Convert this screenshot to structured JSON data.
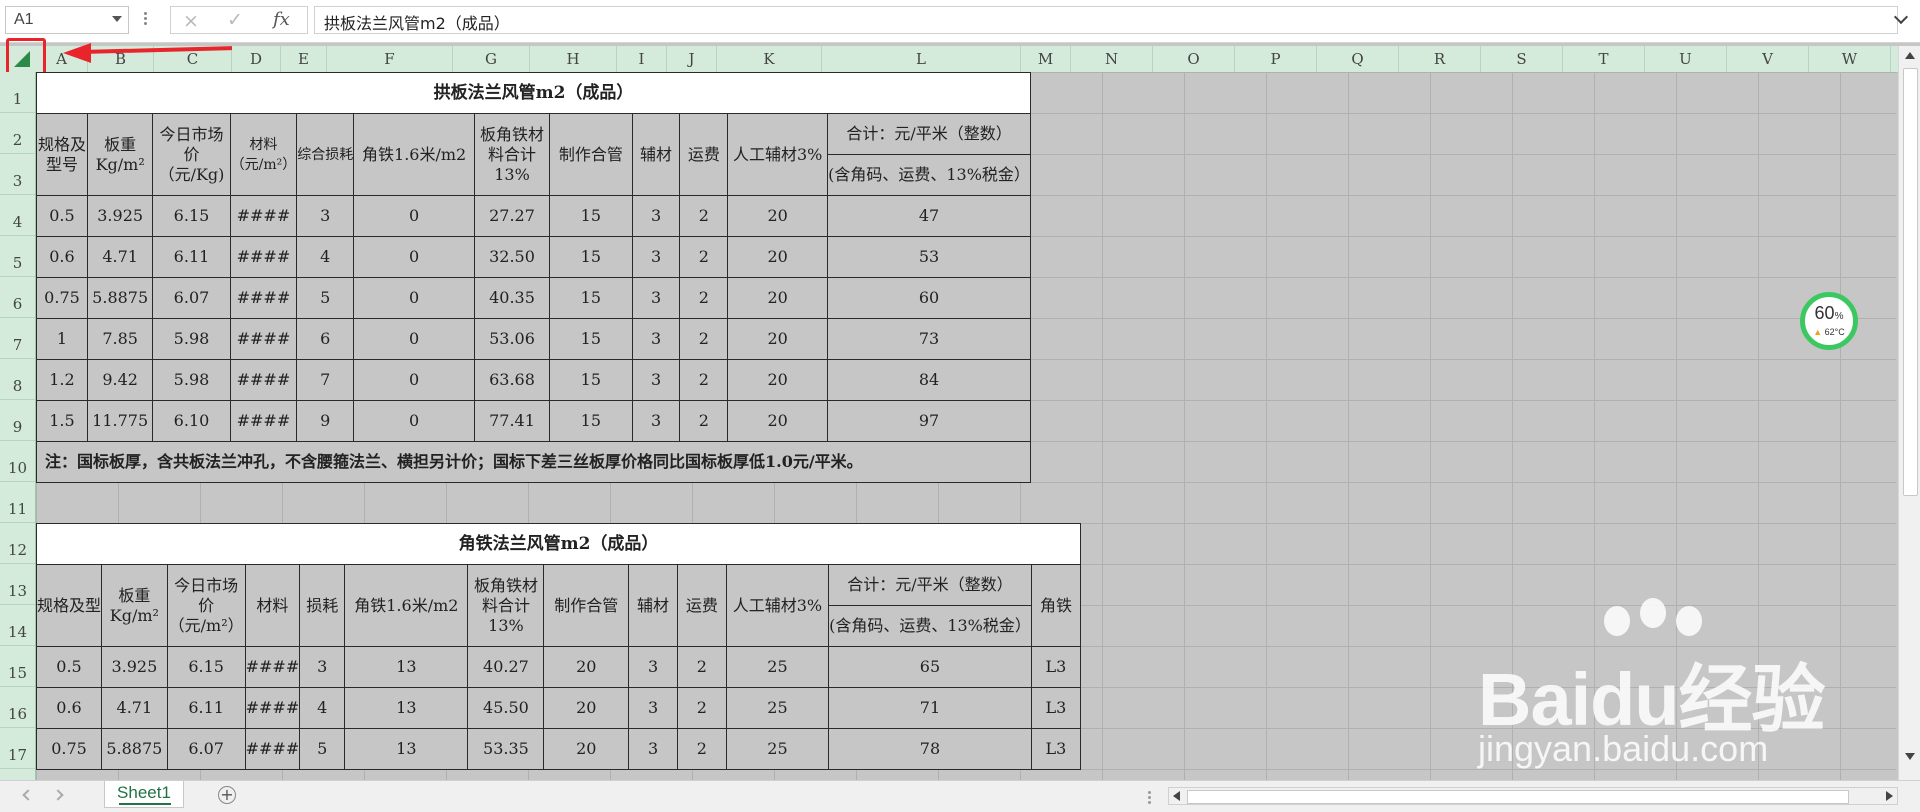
{
  "formula_bar": {
    "name_box": "A1",
    "cancel_icon": "×",
    "enter_icon": "✓",
    "fx_label": "fx",
    "formula": "拱板法兰风管m2（成品）"
  },
  "columns": [
    "A",
    "B",
    "C",
    "D",
    "E",
    "F",
    "G",
    "H",
    "I",
    "J",
    "K",
    "L",
    "M",
    "N",
    "O",
    "P",
    "Q",
    "R",
    "S",
    "T",
    "U",
    "V",
    "W"
  ],
  "rows": [
    "1",
    "2",
    "3",
    "4",
    "5",
    "6",
    "7",
    "8",
    "9",
    "10",
    "11",
    "12",
    "13",
    "14",
    "15",
    "16",
    "17"
  ],
  "table1": {
    "title": "拱板法兰风管m2（成品）",
    "headers": {
      "spec": "规格及型号",
      "weight": "板重Kg/m²",
      "price": "今日市场价 （元/Kg)",
      "material": "材料（元/m²）",
      "loss": "综合损耗",
      "angle": "角铁1.6米/m2",
      "board_sum": "板角铁材料合计13%",
      "make": "制作合管",
      "aux": "辅材",
      "freight": "运费",
      "labor": "人工辅材3%",
      "total": "合计：元/平米（整数）",
      "total_sub": "(含角码、运费、13%税金）"
    },
    "rows": [
      [
        "0.5",
        "3.925",
        "6.15",
        "####",
        "3",
        "0",
        "27.27",
        "15",
        "3",
        "2",
        "20",
        "47"
      ],
      [
        "0.6",
        "4.71",
        "6.11",
        "####",
        "4",
        "0",
        "32.50",
        "15",
        "3",
        "2",
        "20",
        "53"
      ],
      [
        "0.75",
        "5.8875",
        "6.07",
        "####",
        "5",
        "0",
        "40.35",
        "15",
        "3",
        "2",
        "20",
        "60"
      ],
      [
        "1",
        "7.85",
        "5.98",
        "####",
        "6",
        "0",
        "53.06",
        "15",
        "3",
        "2",
        "20",
        "73"
      ],
      [
        "1.2",
        "9.42",
        "5.98",
        "####",
        "7",
        "0",
        "63.68",
        "15",
        "3",
        "2",
        "20",
        "84"
      ],
      [
        "1.5",
        "11.775",
        "6.10",
        "####",
        "9",
        "0",
        "77.41",
        "15",
        "3",
        "2",
        "20",
        "97"
      ]
    ],
    "note": "注：国标板厚，含共板法兰冲孔，不含腰箍法兰、横担另计价；国标下差三丝板厚价格同比国标板厚低1.0元/平米。"
  },
  "table2": {
    "title": "角铁法兰风管m2（成品）",
    "headers": {
      "spec": "规格及型",
      "weight": "板重Kg/m²",
      "price": "今日市场价 （元/m²）",
      "material": "材料",
      "loss": "损耗",
      "angle": "角铁1.6米/m2",
      "board_sum": "板角铁材料合计13%",
      "make": "制作合管",
      "aux": "辅材",
      "freight": "运费",
      "labor": "人工辅材3%",
      "total": "合计：元/平米（整数）",
      "total_sub": "(含角码、运费、13%税金）",
      "angle_spec": "角铁"
    },
    "rows": [
      [
        "0.5",
        "3.925",
        "6.15",
        "####",
        "3",
        "13",
        "40.27",
        "20",
        "3",
        "2",
        "25",
        "65",
        "L3"
      ],
      [
        "0.6",
        "4.71",
        "6.11",
        "####",
        "4",
        "13",
        "45.50",
        "20",
        "3",
        "2",
        "25",
        "71",
        "L3"
      ],
      [
        "0.75",
        "5.8875",
        "6.07",
        "####",
        "5",
        "13",
        "53.35",
        "20",
        "3",
        "2",
        "25",
        "78",
        "L3"
      ]
    ]
  },
  "sheet_tab": "Sheet1",
  "add_sheet": "+",
  "gauge": {
    "percent": "60",
    "unit": "%",
    "temp": "62°C"
  },
  "watermark": {
    "brand": "Baidu经验",
    "url": "jingyan.baidu.com"
  },
  "colors": {
    "header_green": "#d4ebdc",
    "accent_green": "#217346",
    "annotation_red": "#e8252a",
    "cell_gray": "#c6c6c6"
  }
}
